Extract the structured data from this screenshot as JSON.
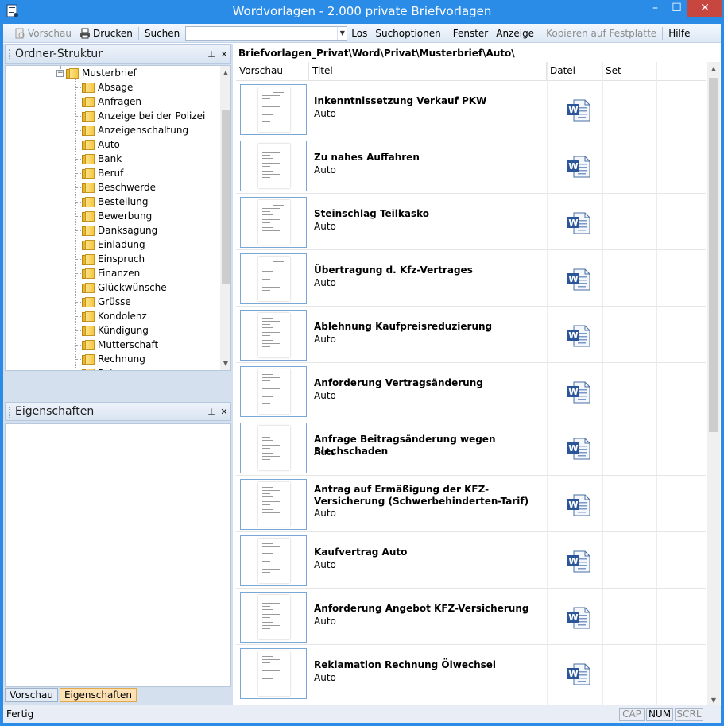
{
  "window": {
    "title": "Wordvorlagen - 2.000 private Briefvorlagen",
    "minimize": "–",
    "maximize": "☐",
    "close": "✕"
  },
  "toolbar": {
    "preview": "Vorschau",
    "print": "Drucken",
    "search_label": "Suchen",
    "search_value": "",
    "go": "Los",
    "search_options": "Suchoptionen",
    "window": "Fenster",
    "view": "Anzeige",
    "copy_to_disk": "Kopieren auf Festplatte",
    "help": "Hilfe"
  },
  "folder_panel": {
    "title": "Ordner-Struktur",
    "pin": "ꟸ",
    "close": "✕",
    "root": "Musterbrief",
    "root_expander": "−",
    "items": [
      "Absage",
      "Anfragen",
      "Anzeige bei der Polizei",
      "Anzeigenschaltung",
      "Auto",
      "Bank",
      "Beruf",
      "Beschwerde",
      "Bestellung",
      "Bewerbung",
      "Danksagung",
      "Einladung",
      "Einspruch",
      "Finanzen",
      "Glückwünsche",
      "Grüsse",
      "Kondolenz",
      "Kündigung",
      "Mutterschaft",
      "Rechnung",
      "Reisen"
    ]
  },
  "props_panel": {
    "title": "Eigenschaften",
    "pin": "ꟸ",
    "close": "✕"
  },
  "bottom_tabs": {
    "preview": "Vorschau",
    "properties": "Eigenschaften"
  },
  "path": "Briefvorlagen_Privat\\Word\\Privat\\Musterbrief\\Auto\\",
  "columns": {
    "preview": "Vorschau",
    "title": "Titel",
    "file": "Datei",
    "set": "Set"
  },
  "rows": [
    {
      "title": "Inkenntnissetzung Verkauf PKW",
      "category": "Auto"
    },
    {
      "title": "Zu nahes Auffahren",
      "category": "Auto"
    },
    {
      "title": "Steinschlag Teilkasko",
      "category": "Auto"
    },
    {
      "title": "Übertragung d. Kfz-Vertrages",
      "category": "Auto"
    },
    {
      "title": "Ablehnung Kaufpreisreduzierung",
      "category": "Auto"
    },
    {
      "title": "Anforderung Vertragsänderung",
      "category": "Auto"
    },
    {
      "title": "Anfrage Beitragsänderung wegen Blechschaden",
      "category": "Auto"
    },
    {
      "title": "Antrag auf Ermäßigung der KFZ-Versicherung (Schwerbehinderten-Tarif)",
      "category": "Auto"
    },
    {
      "title": "Kaufvertrag Auto",
      "category": "Auto"
    },
    {
      "title": "Anforderung Angebot KFZ-Versicherung",
      "category": "Auto"
    },
    {
      "title": "Reklamation Rechnung Ölwechsel",
      "category": "Auto"
    }
  ],
  "status": {
    "text": "Fertig",
    "cap": "CAP",
    "num": "NUM",
    "scrl": "SCRL"
  },
  "colors": {
    "titlebar": "#2b8ce8",
    "close_button": "#c7463f",
    "folder": "#f4c843",
    "active_tab": "#fde1b3"
  }
}
